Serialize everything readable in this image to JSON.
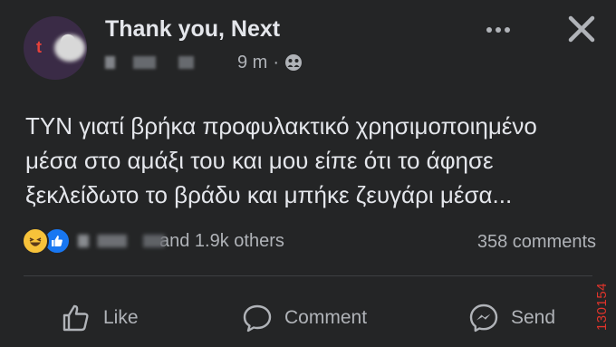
{
  "post": {
    "group_name": "Thank you, Next",
    "time": "9 m",
    "separator": "·",
    "body": "ΤΥΝ γιατί βρήκα προφυλακτικό χρησιμοποιημένο\nμέσα στο αμάξι του και μου είπε ότι το άφησε\nξεκλείδωτο το βράδυ και μπήκε ζευγάρι μέσα...",
    "reactions_others": "and 1.9k others",
    "comments_count": "358 comments"
  },
  "actions": {
    "like_label": "Like",
    "comment_label": "Comment",
    "send_label": "Send"
  },
  "watermark": "130154",
  "icons": {
    "privacy": "group-members-icon",
    "more": "more-options-icon",
    "close": "close-icon",
    "reaction_1": "haha-reaction-icon",
    "reaction_2": "like-reaction-icon",
    "like": "thumbs-up-icon",
    "comment": "comment-bubble-icon",
    "send": "messenger-icon"
  },
  "colors": {
    "background": "#242526",
    "primary_text": "#e4e6eb",
    "secondary_text": "#b0b3b8",
    "like_blue": "#1877f2",
    "haha_yellow": "#f7c23a",
    "watermark_red": "#e0342b"
  }
}
